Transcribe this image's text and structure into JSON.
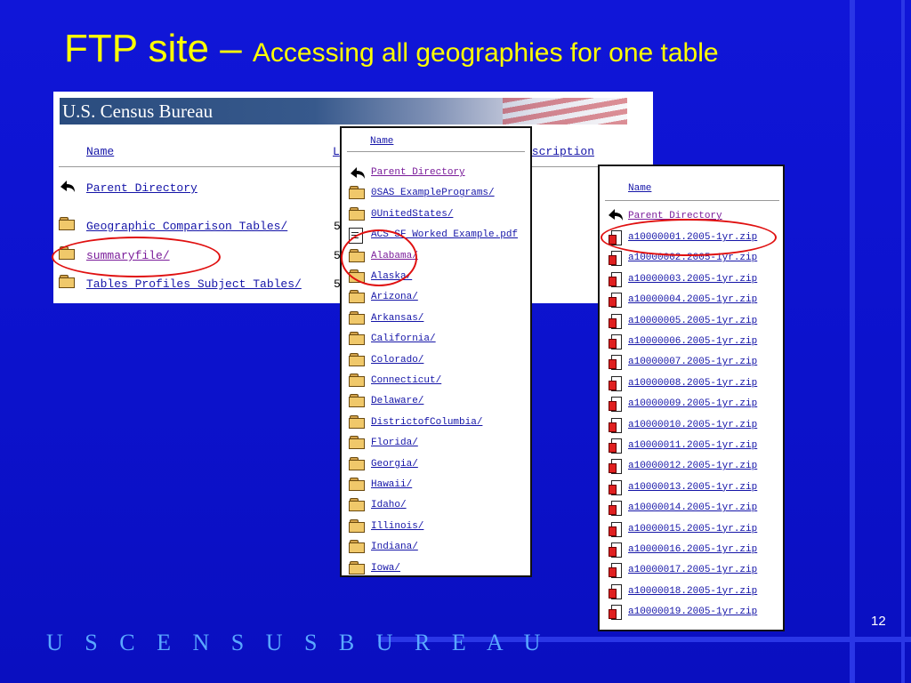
{
  "slide": {
    "title_main": "FTP site – ",
    "title_sub": "Accessing all geographies for one table",
    "page_number": "12",
    "footer": "U S C E N S U S B U R E A U"
  },
  "panel1": {
    "banner": "U.S. Census Bureau",
    "columns": {
      "name": "Name",
      "last_modified_partial": "L",
      "description_partial": "escription"
    },
    "rows": [
      {
        "name": "Parent Directory",
        "partial": "",
        "icon": "back-arrow-icon"
      },
      {
        "name": "Geographic Comparison Tables/",
        "partial": "5",
        "icon": "folder-icon"
      },
      {
        "name": "summaryfile/",
        "partial": "5",
        "icon": "folder-icon"
      },
      {
        "name": "Tables Profiles Subject Tables/",
        "partial": "5",
        "icon": "folder-icon"
      }
    ]
  },
  "panel2": {
    "column": "Name",
    "rows": [
      {
        "name": "Parent Directory",
        "icon": "back-arrow-icon"
      },
      {
        "name": "0SAS ExamplePrograms/",
        "icon": "folder-icon"
      },
      {
        "name": "0UnitedStates/",
        "icon": "folder-icon"
      },
      {
        "name": "ACS SF Worked Example.pdf",
        "icon": "document-icon"
      },
      {
        "name": "Alabama/",
        "icon": "folder-icon"
      },
      {
        "name": "Alaska/",
        "icon": "folder-icon"
      },
      {
        "name": "Arizona/",
        "icon": "folder-icon"
      },
      {
        "name": "Arkansas/",
        "icon": "folder-icon"
      },
      {
        "name": "California/",
        "icon": "folder-icon"
      },
      {
        "name": "Colorado/",
        "icon": "folder-icon"
      },
      {
        "name": "Connecticut/",
        "icon": "folder-icon"
      },
      {
        "name": "Delaware/",
        "icon": "folder-icon"
      },
      {
        "name": "DistrictofColumbia/",
        "icon": "folder-icon"
      },
      {
        "name": "Florida/",
        "icon": "folder-icon"
      },
      {
        "name": "Georgia/",
        "icon": "folder-icon"
      },
      {
        "name": "Hawaii/",
        "icon": "folder-icon"
      },
      {
        "name": "Idaho/",
        "icon": "folder-icon"
      },
      {
        "name": "Illinois/",
        "icon": "folder-icon"
      },
      {
        "name": "Indiana/",
        "icon": "folder-icon"
      },
      {
        "name": "Iowa/",
        "icon": "folder-icon"
      }
    ]
  },
  "panel3": {
    "column": "Name",
    "parent": "Parent Directory",
    "files": [
      "a10000001.2005-1yr.zip",
      "a10000002.2005-1yr.zip",
      "a10000003.2005-1yr.zip",
      "a10000004.2005-1yr.zip",
      "a10000005.2005-1yr.zip",
      "a10000006.2005-1yr.zip",
      "a10000007.2005-1yr.zip",
      "a10000008.2005-1yr.zip",
      "a10000009.2005-1yr.zip",
      "a10000010.2005-1yr.zip",
      "a10000011.2005-1yr.zip",
      "a10000012.2005-1yr.zip",
      "a10000013.2005-1yr.zip",
      "a10000014.2005-1yr.zip",
      "a10000015.2005-1yr.zip",
      "a10000016.2005-1yr.zip",
      "a10000017.2005-1yr.zip",
      "a10000018.2005-1yr.zip",
      "a10000019.2005-1yr.zip"
    ]
  },
  "highlights": {
    "color": "#e01010"
  },
  "colors": {
    "background": "#0c12cc",
    "title": "#ffff00",
    "footer": "#5aa8ff",
    "link": "#1515a8",
    "visited": "#7a1c9a"
  }
}
